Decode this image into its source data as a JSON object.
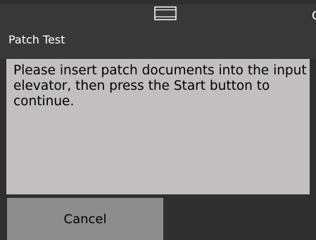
{
  "header": {
    "title": "Patch Test",
    "center_icon": "tray-icon",
    "corner_text": "C"
  },
  "message": {
    "text": "Please insert patch documents into the input elevator, then press the Start button to continue."
  },
  "footer": {
    "cancel_label": "Cancel"
  },
  "colors": {
    "background": "#2f2f2f",
    "header": "#383838",
    "message_panel": "#c2bfc1",
    "button": "#8d8d8d",
    "header_text": "#ffffff",
    "body_text": "#000000"
  }
}
